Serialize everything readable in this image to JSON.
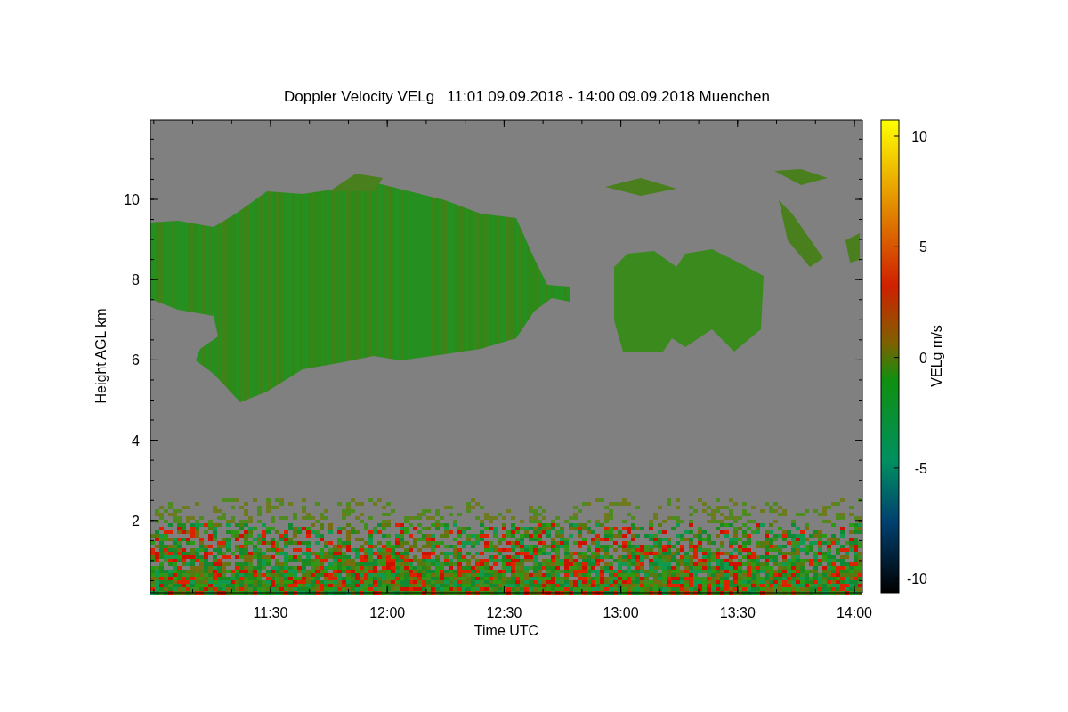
{
  "title": "Doppler Velocity VELg   11:01 09.09.2018 - 14:00 09.09.2018 Muenchen",
  "plot": {
    "xlabel": "Time UTC",
    "ylabel": "Height AGL km",
    "xticks": [
      "11:30",
      "12:00",
      "12:30",
      "13:00",
      "13:30",
      "14:00"
    ],
    "yticks": [
      "10",
      "8",
      "6",
      "4",
      "2"
    ]
  },
  "colorbar": {
    "label": "VELg m/s",
    "ticks": [
      "10",
      "5",
      "0",
      "-5",
      "-10"
    ]
  }
}
